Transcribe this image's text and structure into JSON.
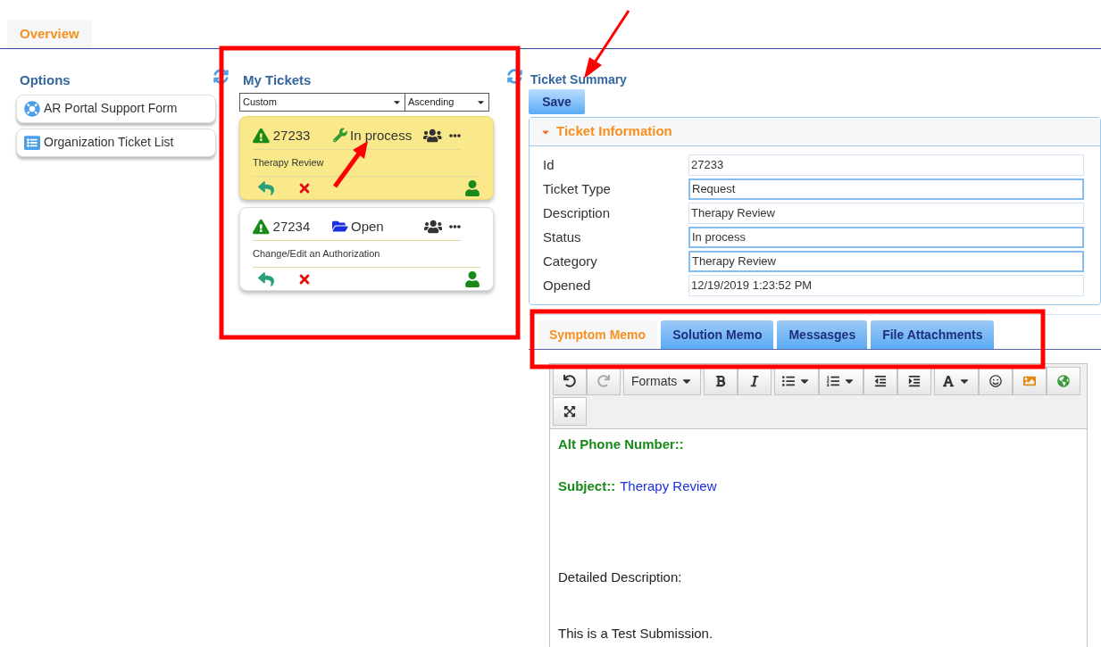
{
  "top_tabs": [
    {
      "label": "Overview",
      "selected": true
    }
  ],
  "options": {
    "title": "Options",
    "items": [
      {
        "label": "AR Portal Support Form",
        "kind": "support"
      },
      {
        "label": "Organization Ticket List",
        "kind": "list"
      }
    ]
  },
  "my_tickets": {
    "title": "My Tickets",
    "sort_field": "Custom",
    "sort_order": "Ascending",
    "tickets": [
      {
        "id": "27233",
        "status": "In process",
        "kind": "wrench",
        "subject": "Therapy Review",
        "selected": true
      },
      {
        "id": "27234",
        "status": "Open",
        "kind": "folder",
        "subject": "Change/Edit an Authorization",
        "selected": false
      }
    ]
  },
  "ticket_summary": {
    "title": "Ticket Summary",
    "save": "Save",
    "section": "Ticket Information",
    "fields": [
      {
        "label": "Id",
        "value": "27233",
        "editable": false
      },
      {
        "label": "Ticket Type",
        "value": "Request",
        "editable": true
      },
      {
        "label": "Description",
        "value": "Therapy Review",
        "editable": false
      },
      {
        "label": "Status",
        "value": "In process",
        "editable": true
      },
      {
        "label": "Category",
        "value": "Therapy Review",
        "editable": true
      },
      {
        "label": "Opened",
        "value": "12/19/2019 1:23:52 PM",
        "editable": false
      }
    ]
  },
  "memo_tabs": [
    {
      "label": "Symptom Memo",
      "selected": true
    },
    {
      "label": "Solution Memo",
      "selected": false
    },
    {
      "label": "Messasges",
      "selected": false
    },
    {
      "label": "File Attachments",
      "selected": false
    }
  ],
  "editor": {
    "formats": "Formats",
    "fields": [
      {
        "label": "Alt Phone Number::"
      },
      {
        "label": "Subject::",
        "value": "Therapy Review"
      }
    ],
    "paragraphs": [
      "Detailed Description:",
      "This is a Test Submission."
    ]
  }
}
